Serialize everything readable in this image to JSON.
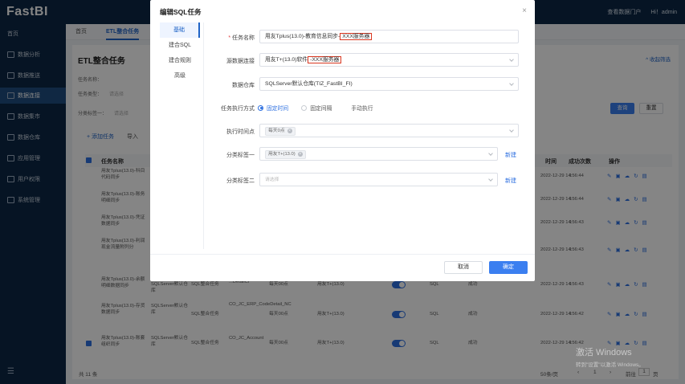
{
  "app": {
    "logo": "FastBI"
  },
  "topbar": {
    "link1": "查看数据门户",
    "user": "Hi！admin"
  },
  "sidebar": {
    "items": [
      {
        "label": "首页"
      },
      {
        "label": "数据分析"
      },
      {
        "label": "数据推送"
      },
      {
        "label": "数据连接"
      },
      {
        "label": "数据集市"
      },
      {
        "label": "数据仓库"
      },
      {
        "label": "应用管理"
      },
      {
        "label": "用户权限"
      },
      {
        "label": "系统管理"
      }
    ],
    "active_index": 3,
    "footer_icon": "menu-fold-icon"
  },
  "tabs": [
    {
      "label": "首页"
    },
    {
      "label": "ETL整合任务"
    }
  ],
  "page": {
    "title": "ETL整合任务",
    "collapse": "^ 收起筛选",
    "filter_labels": {
      "name": "任务名称：",
      "type": "任务类型：",
      "tag1": "分类标签一："
    },
    "filter_placeholders": {
      "type": "请选择",
      "tag1": "请选择"
    },
    "query_btn": "查询",
    "reset_btn": "重置",
    "add_task": "+ 添加任务",
    "import": "导入",
    "columns": {
      "name": "任务名称",
      "time": "时间",
      "count": "成功次数",
      "ops": "操作"
    },
    "rows": [
      {
        "name": "用友Tplus(13.0)-科目代码同步",
        "time": "2022-12-29 14:56:44",
        "count": "1"
      },
      {
        "name": "用友Tplus(13.0)-账务明细同步",
        "time": "2022-12-29 14:56:44",
        "count": "1"
      },
      {
        "name": "用友Tplus(13.0)-凭证数据同步",
        "time": "2022-12-29 14:56:43",
        "count": "1"
      },
      {
        "name": "用友Tplus(13.0)-利润现金流量附列分",
        "time": "2022-12-29 14:56:43",
        "count": "1"
      },
      {
        "name": "用友Tplus(13.0)-余额明细数据同步",
        "db": "SQLServer默认仓库",
        "type": "SQL整合任务",
        "table": "...DetailCl",
        "schedule": "每天00点",
        "src": "用友T+(13.0)",
        "type2": "SQL",
        "status": "成功",
        "time": "2022-12-29 14:56:43",
        "count": "1"
      },
      {
        "name": "用友Tplus(13.0)-存货数据同步",
        "db": "SQLServer默认仓库",
        "type": "SQL整合任务",
        "table": "CO_JC_ERP_CodeDetail_NC",
        "schedule": "每天00点",
        "src": "用友T+(13.0)",
        "type2": "SQL",
        "status": "成功",
        "time": "2022-12-29 14:56:42",
        "count": "1"
      },
      {
        "name": "用友Tplus(13.0)-账套组织同步",
        "db": "SQLServer默认仓库",
        "type": "SQL整合任务",
        "table": "CO_JC_Account",
        "schedule": "每天00点",
        "src": "用友T+(13.0)",
        "type2": "SQL",
        "status": "成功",
        "time": "2022-12-29 14:56:42",
        "count": "1"
      }
    ],
    "total": "共 11 条",
    "page_size": "50条/页",
    "page_num": "1",
    "goto": "前往",
    "page_unit": "页"
  },
  "modal": {
    "title": "编辑SQL任务",
    "close": "×",
    "nav": [
      {
        "label": "基础"
      },
      {
        "label": "建合SQL"
      },
      {
        "label": "建合规则"
      },
      {
        "label": "高级"
      }
    ],
    "fields": {
      "task_name": {
        "label": "任务名称",
        "value_prefix": "用友Tplus(13.0)-教育信息同步",
        "value_highlight": "XXX服务器"
      },
      "source": {
        "label": "源数据连接",
        "value_prefix": "用友T+(13.0)软件",
        "value_highlight": "-XXX服务器"
      },
      "warehouse": {
        "label": "数据仓库",
        "value": "SQLServer默认仓库(TIZ_FastBI_FI)"
      },
      "exec_mode": {
        "label": "任务执行方式",
        "options": [
          "固定时间",
          "固定间隔",
          "手动执行"
        ],
        "selected": "固定时间"
      },
      "exec_time": {
        "label": "执行时间点",
        "tag": "每天0点"
      },
      "tag1": {
        "label": "分类标签一",
        "tag": "用友T+(13.0)",
        "new": "新建"
      },
      "tag2": {
        "label": "分类标签二",
        "placeholder": "请选择",
        "new": "新建"
      }
    },
    "cancel": "取消",
    "confirm": "确定"
  },
  "watermark": {
    "line1": "激活 Windows",
    "line2": "转到\"设置\"以激活 Windows。"
  }
}
